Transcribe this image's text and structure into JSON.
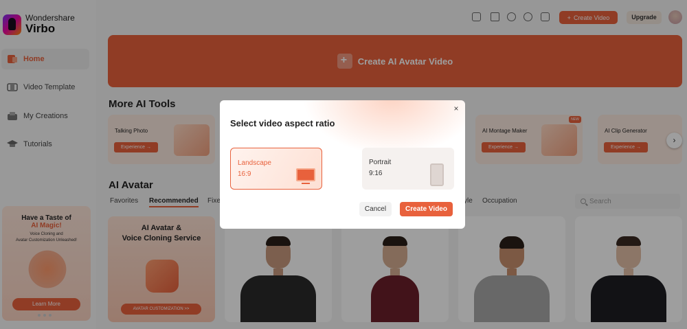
{
  "app": {
    "brand_line1": "Wondershare",
    "brand_line2": "Virbo"
  },
  "sidebar": {
    "items": [
      {
        "label": "Home",
        "icon": "home-icon",
        "active": true
      },
      {
        "label": "Video Template",
        "icon": "video-template-icon"
      },
      {
        "label": "My Creations",
        "icon": "my-creations-icon"
      },
      {
        "label": "Tutorials",
        "icon": "tutorials-icon"
      }
    ],
    "promo": {
      "line1": "Have a Taste of",
      "line2": "AI Magic!",
      "line3a": "Voice Cloning and",
      "line3b": "Avatar Customization Unleashed!",
      "button": "Learn More"
    }
  },
  "topbar": {
    "create_label": "Create Video",
    "upgrade_label": "Upgrade"
  },
  "hero": {
    "label": "Create AI Avatar Video"
  },
  "tools": {
    "title": "More AI Tools",
    "button_label": "Experience →",
    "items": [
      {
        "name": "Talking Photo"
      },
      {
        "name": "AI Montage Maker",
        "badge": "NEW"
      },
      {
        "name": "AI Clip Generator"
      }
    ]
  },
  "avatars": {
    "title": "AI Avatar",
    "tabs": [
      "Favorites",
      "Recommended",
      "Fixe",
      "yle",
      "Occupation"
    ],
    "search_placeholder": "Search",
    "promo_title_1": "AI Avatar &",
    "promo_title_2": "Voice Cloning Service",
    "promo_button": "AVATAR CUSTOMIZATION >>"
  },
  "modal": {
    "title": "Select video aspect ratio",
    "close": "×",
    "options": [
      {
        "name": "Landscape",
        "ratio": "16:9",
        "selected": true
      },
      {
        "name": "Portrait",
        "ratio": "9:16",
        "selected": false
      }
    ],
    "cancel_label": "Cancel",
    "create_label": "Create Video"
  },
  "colors": {
    "accent": "#e8613c",
    "overlay": "rgba(0,0,0,0.38)"
  }
}
